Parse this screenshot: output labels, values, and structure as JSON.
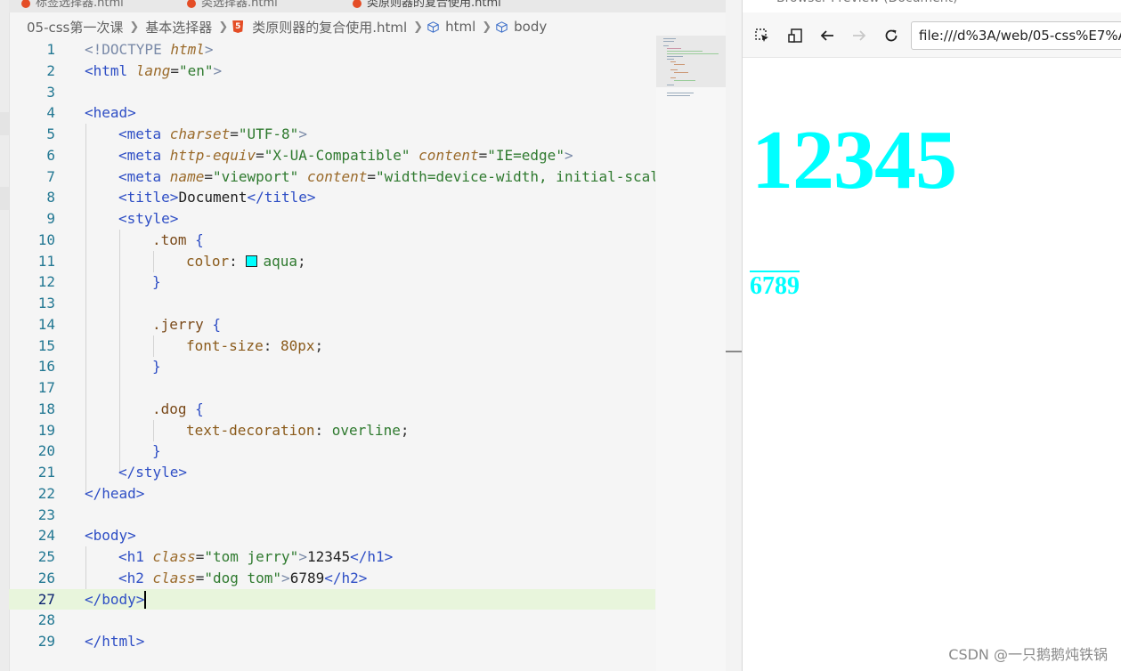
{
  "tabs": [
    {
      "label": "标签选择器.html"
    },
    {
      "label": "类选择器.html"
    },
    {
      "label": "类原则器的复合使用.html"
    }
  ],
  "breadcrumb": {
    "folder": "05-css第一次课",
    "subfolder": "基本选择器",
    "file": "类原则器的复合使用.html",
    "node1": "html",
    "node2": "body"
  },
  "code_lines": [
    {
      "n": "1"
    },
    {
      "n": "2"
    },
    {
      "n": "3"
    },
    {
      "n": "4"
    },
    {
      "n": "5"
    },
    {
      "n": "6"
    },
    {
      "n": "7"
    },
    {
      "n": "8"
    },
    {
      "n": "9"
    },
    {
      "n": "10"
    },
    {
      "n": "11"
    },
    {
      "n": "12"
    },
    {
      "n": "13"
    },
    {
      "n": "14"
    },
    {
      "n": "15"
    },
    {
      "n": "16"
    },
    {
      "n": "17"
    },
    {
      "n": "18"
    },
    {
      "n": "19"
    },
    {
      "n": "20"
    },
    {
      "n": "21"
    },
    {
      "n": "22"
    },
    {
      "n": "23"
    },
    {
      "n": "24"
    },
    {
      "n": "25"
    },
    {
      "n": "26"
    },
    {
      "n": "27"
    },
    {
      "n": "28"
    },
    {
      "n": "29"
    }
  ],
  "code": {
    "l1_a": "<!DOCTYPE ",
    "l1_b": "html",
    "l1_c": ">",
    "l2_a": "<html ",
    "l2_b": "lang",
    "l2_c": "=",
    "l2_d": "\"en\"",
    "l2_e": ">",
    "l4": "<head>",
    "l5_a": "<meta ",
    "l5_b": "charset",
    "l5_c": "=",
    "l5_d": "\"UTF-8\"",
    "l5_e": ">",
    "l6_a": "<meta ",
    "l6_b": "http-equiv",
    "l6_c": "=",
    "l6_d": "\"X-UA-Compatible\"",
    "l6_e": " ",
    "l6_f": "content",
    "l6_g": "=",
    "l6_h": "\"IE=edge\"",
    "l6_i": ">",
    "l7_a": "<meta ",
    "l7_b": "name",
    "l7_c": "=",
    "l7_d": "\"viewport\"",
    "l7_e": " ",
    "l7_f": "content",
    "l7_g": "=",
    "l7_h": "\"width=device-width, initial-scal",
    "l8_a": "<title>",
    "l8_b": "Document",
    "l8_c": "</title>",
    "l9": "<style>",
    "l10_a": ".tom",
    "l10_b": " {",
    "l11_a": "color",
    "l11_b": ": ",
    "l11_c": "aqua",
    "l11_d": ";",
    "l12": "}",
    "l14_a": ".jerry",
    "l14_b": " {",
    "l15_a": "font-size",
    "l15_b": ": ",
    "l15_c": "80px",
    "l15_d": ";",
    "l16": "}",
    "l18_a": ".dog",
    "l18_b": " {",
    "l19_a": "text-decoration",
    "l19_b": ": ",
    "l19_c": "overline",
    "l19_d": ";",
    "l20": "}",
    "l21": "</style>",
    "l22": "</head>",
    "l24": "<body>",
    "l25_a": "<h1 ",
    "l25_b": "class",
    "l25_c": "=",
    "l25_d": "\"tom jerry\"",
    "l25_e": ">",
    "l25_f": "12345",
    "l25_g": "</h1>",
    "l26_a": "<h2 ",
    "l26_b": "class",
    "l26_c": "=",
    "l26_d": "\"dog tom\"",
    "l26_e": ">",
    "l26_f": "6789",
    "l26_g": "</h2>",
    "l27": "</body>",
    "l29": "</html>"
  },
  "colors": {
    "aqua": "#00ffff",
    "current_line": "#e8f5dc"
  },
  "preview": {
    "title": "Browser Preview (Document)",
    "url": "file:///d%3A/web/05-css%E7%A",
    "h1_text": "12345",
    "h2_text": "6789"
  },
  "toolbar_icons": [
    "inspect-icon",
    "device-toggle-icon",
    "back-arrow-icon",
    "forward-arrow-icon",
    "reload-icon"
  ],
  "watermark": "CSDN @一只鹅鹅炖铁锅"
}
